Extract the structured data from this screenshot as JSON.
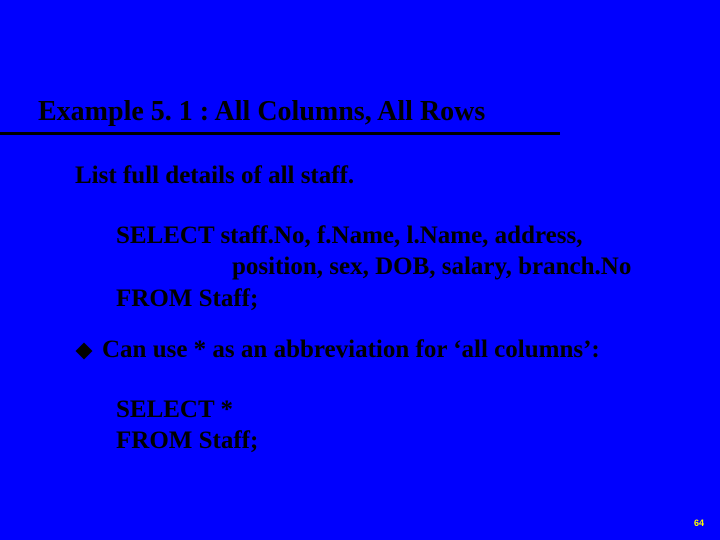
{
  "title": "Example 5. 1 : All Columns, All Rows",
  "intro": "List full details of all staff.",
  "code1": {
    "line1": "SELECT staff.No, f.Name, l.Name, address,",
    "line2": "position, sex, DOB, salary, branch.No",
    "line3": "FROM Staff;"
  },
  "bullet": "Can use * as an abbreviation for ‘all columns’:",
  "code2": {
    "line1": "SELECT *",
    "line2": "FROM Staff;"
  },
  "pagenum": "64"
}
